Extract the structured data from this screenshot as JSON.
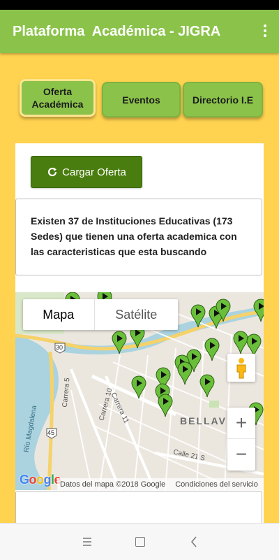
{
  "app": {
    "title": "Plataforma  Académica - JIGRA"
  },
  "tabs": [
    {
      "label": "Oferta Académica"
    },
    {
      "label": "Eventos"
    },
    {
      "label": "Directorio I.E"
    }
  ],
  "actions": {
    "load_offer_label": "Cargar Oferta"
  },
  "info": {
    "message": "Existen 37 de Instituciones Educativas (173 Sedes) que tienen una oferta academica con las caracteristicas que esta buscando"
  },
  "map": {
    "type_options": [
      "Mapa",
      "Satélite"
    ],
    "zoom_in": "+",
    "zoom_out": "−",
    "footer_copyright": "Datos del mapa ©2018 Google",
    "footer_terms": "Condiciones del servicio",
    "logo": "Google",
    "labels": {
      "river": "Río Magdalena",
      "route_30": "30",
      "route_45": "45",
      "carrera5": "Carrera 5",
      "carrera10": "Carrera 10",
      "carrera11": "Carrera 11",
      "calle21": "Calle 21 S",
      "neighborhood": "BELLAV"
    },
    "marker_color": "#6abf3a"
  },
  "colors": {
    "app_bar": "#8bc34a",
    "background": "#ffd34f",
    "button_dark": "#4a7d0f"
  }
}
